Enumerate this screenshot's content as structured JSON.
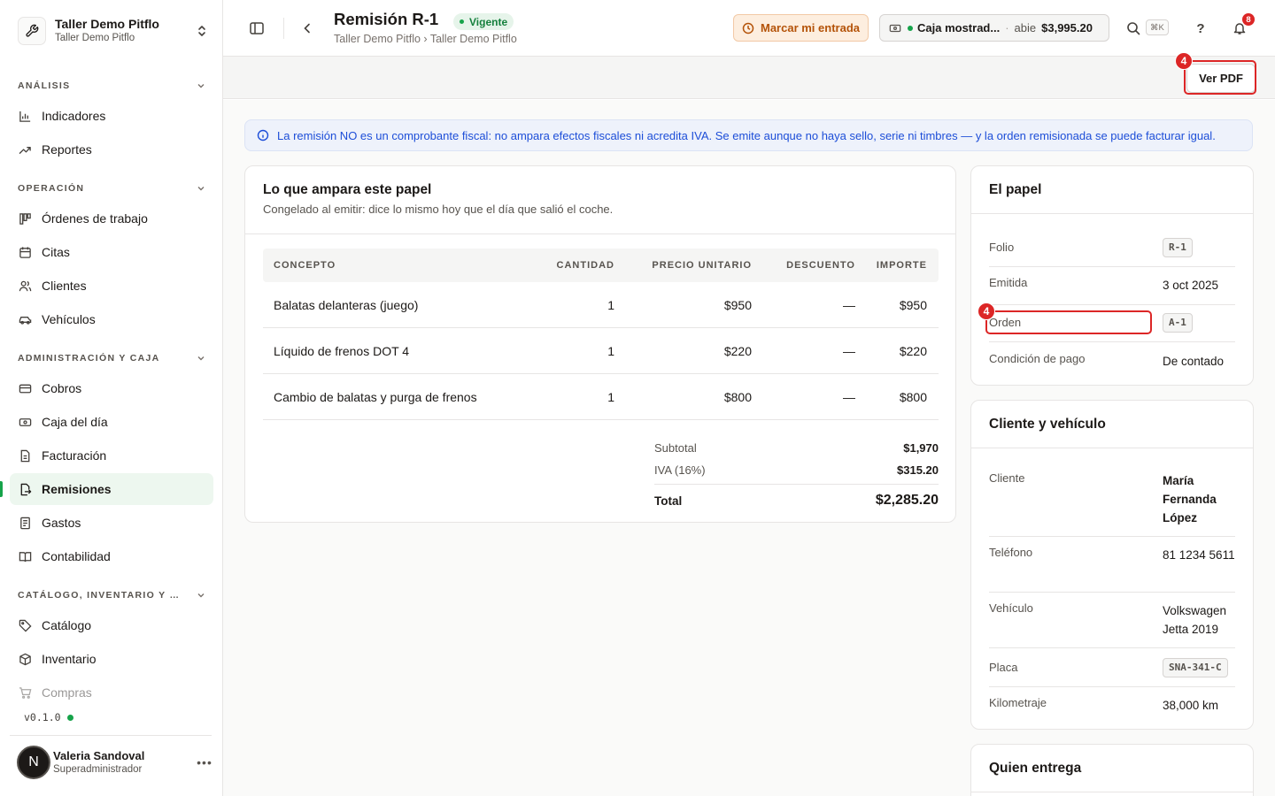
{
  "org": {
    "name": "Taller Demo Pitflo",
    "subtitle": "Taller Demo Pitflo"
  },
  "nav": {
    "sections": [
      {
        "label": "ANÁLISIS",
        "items": [
          {
            "label": "Indicadores",
            "icon": "bar-chart-icon"
          },
          {
            "label": "Reportes",
            "icon": "trend-icon"
          }
        ]
      },
      {
        "label": "OPERACIÓN",
        "items": [
          {
            "label": "Órdenes de trabajo",
            "icon": "kanban-icon"
          },
          {
            "label": "Citas",
            "icon": "calendar-icon"
          },
          {
            "label": "Clientes",
            "icon": "users-icon"
          },
          {
            "label": "Vehículos",
            "icon": "car-icon"
          }
        ]
      },
      {
        "label": "ADMINISTRACIÓN Y CAJA",
        "items": [
          {
            "label": "Cobros",
            "icon": "card-icon"
          },
          {
            "label": "Caja del día",
            "icon": "cash-icon"
          },
          {
            "label": "Facturación",
            "icon": "file-icon"
          },
          {
            "label": "Remisiones",
            "icon": "file-out-icon",
            "active": true
          },
          {
            "label": "Gastos",
            "icon": "receipt-icon"
          },
          {
            "label": "Contabilidad",
            "icon": "book-icon"
          }
        ]
      },
      {
        "label": "CATÁLOGO, INVENTARIO Y COMPRAS",
        "items": [
          {
            "label": "Catálogo",
            "icon": "tag-icon"
          },
          {
            "label": "Inventario",
            "icon": "box-icon"
          },
          {
            "label": "Compras",
            "icon": "cart-icon"
          }
        ]
      }
    ],
    "version": "v0.1.0"
  },
  "user": {
    "initial": "N",
    "name": "Valeria Sandoval",
    "role": "Superadministrador"
  },
  "header": {
    "title": "Remisión R-1",
    "status": "Vigente",
    "breadcrumb": "Taller Demo Pitflo › Taller Demo Pitflo",
    "clock_in_label": "Marcar mi entrada",
    "register": {
      "name": "Caja mostrad...",
      "separator": "·",
      "status": "abie",
      "amount": "$3,995.20"
    },
    "search_shortcut": "⌘K",
    "help_label": "?",
    "notifications_count": "8"
  },
  "toolbar": {
    "pdf_label": "Ver PDF"
  },
  "banner": {
    "text": "La remisión NO es un comprobante fiscal: no ampara efectos fiscales ni acredita IVA. Se emite aunque no haya sello, serie ni timbres — y la orden remisionada se puede facturar igual."
  },
  "items_card": {
    "title": "Lo que ampara este papel",
    "subtitle": "Congelado al emitir: dice lo mismo hoy que el día que salió el coche.",
    "columns": [
      "CONCEPTO",
      "CANTIDAD",
      "PRECIO UNITARIO",
      "DESCUENTO",
      "IMPORTE"
    ],
    "rows": [
      [
        "Balatas delanteras (juego)",
        "1",
        "$950",
        "—",
        "$950"
      ],
      [
        "Líquido de frenos DOT 4",
        "1",
        "$220",
        "—",
        "$220"
      ],
      [
        "Cambio de balatas y purga de frenos",
        "1",
        "$800",
        "—",
        "$800"
      ]
    ],
    "subtotal_label": "Subtotal",
    "subtotal": "$1,970",
    "tax_label": "IVA (16%)",
    "tax": "$315.20",
    "total_label": "Total",
    "total": "$2,285.20"
  },
  "papel": {
    "title": "El papel",
    "folio_label": "Folio",
    "folio": "R-1",
    "issued_label": "Emitida",
    "issued": "3 oct 2025",
    "order_label": "Orden",
    "order": "A-1",
    "payment_label": "Condición de pago",
    "payment": "De contado"
  },
  "cliente": {
    "title": "Cliente y vehículo",
    "client_label": "Cliente",
    "client": "María Fernanda López",
    "phone_label": "Teléfono",
    "phone": "81 1234 5611",
    "vehicle_label": "Vehículo",
    "vehicle": "Volkswagen Jetta 2019",
    "plate_label": "Placa",
    "plate": "SNA-341-C",
    "mileage_label": "Kilometraje",
    "mileage": "38,000 km"
  },
  "entrega": {
    "title": "Quien entrega"
  },
  "annotations": [
    {
      "number": "4"
    },
    {
      "number": "4"
    }
  ]
}
